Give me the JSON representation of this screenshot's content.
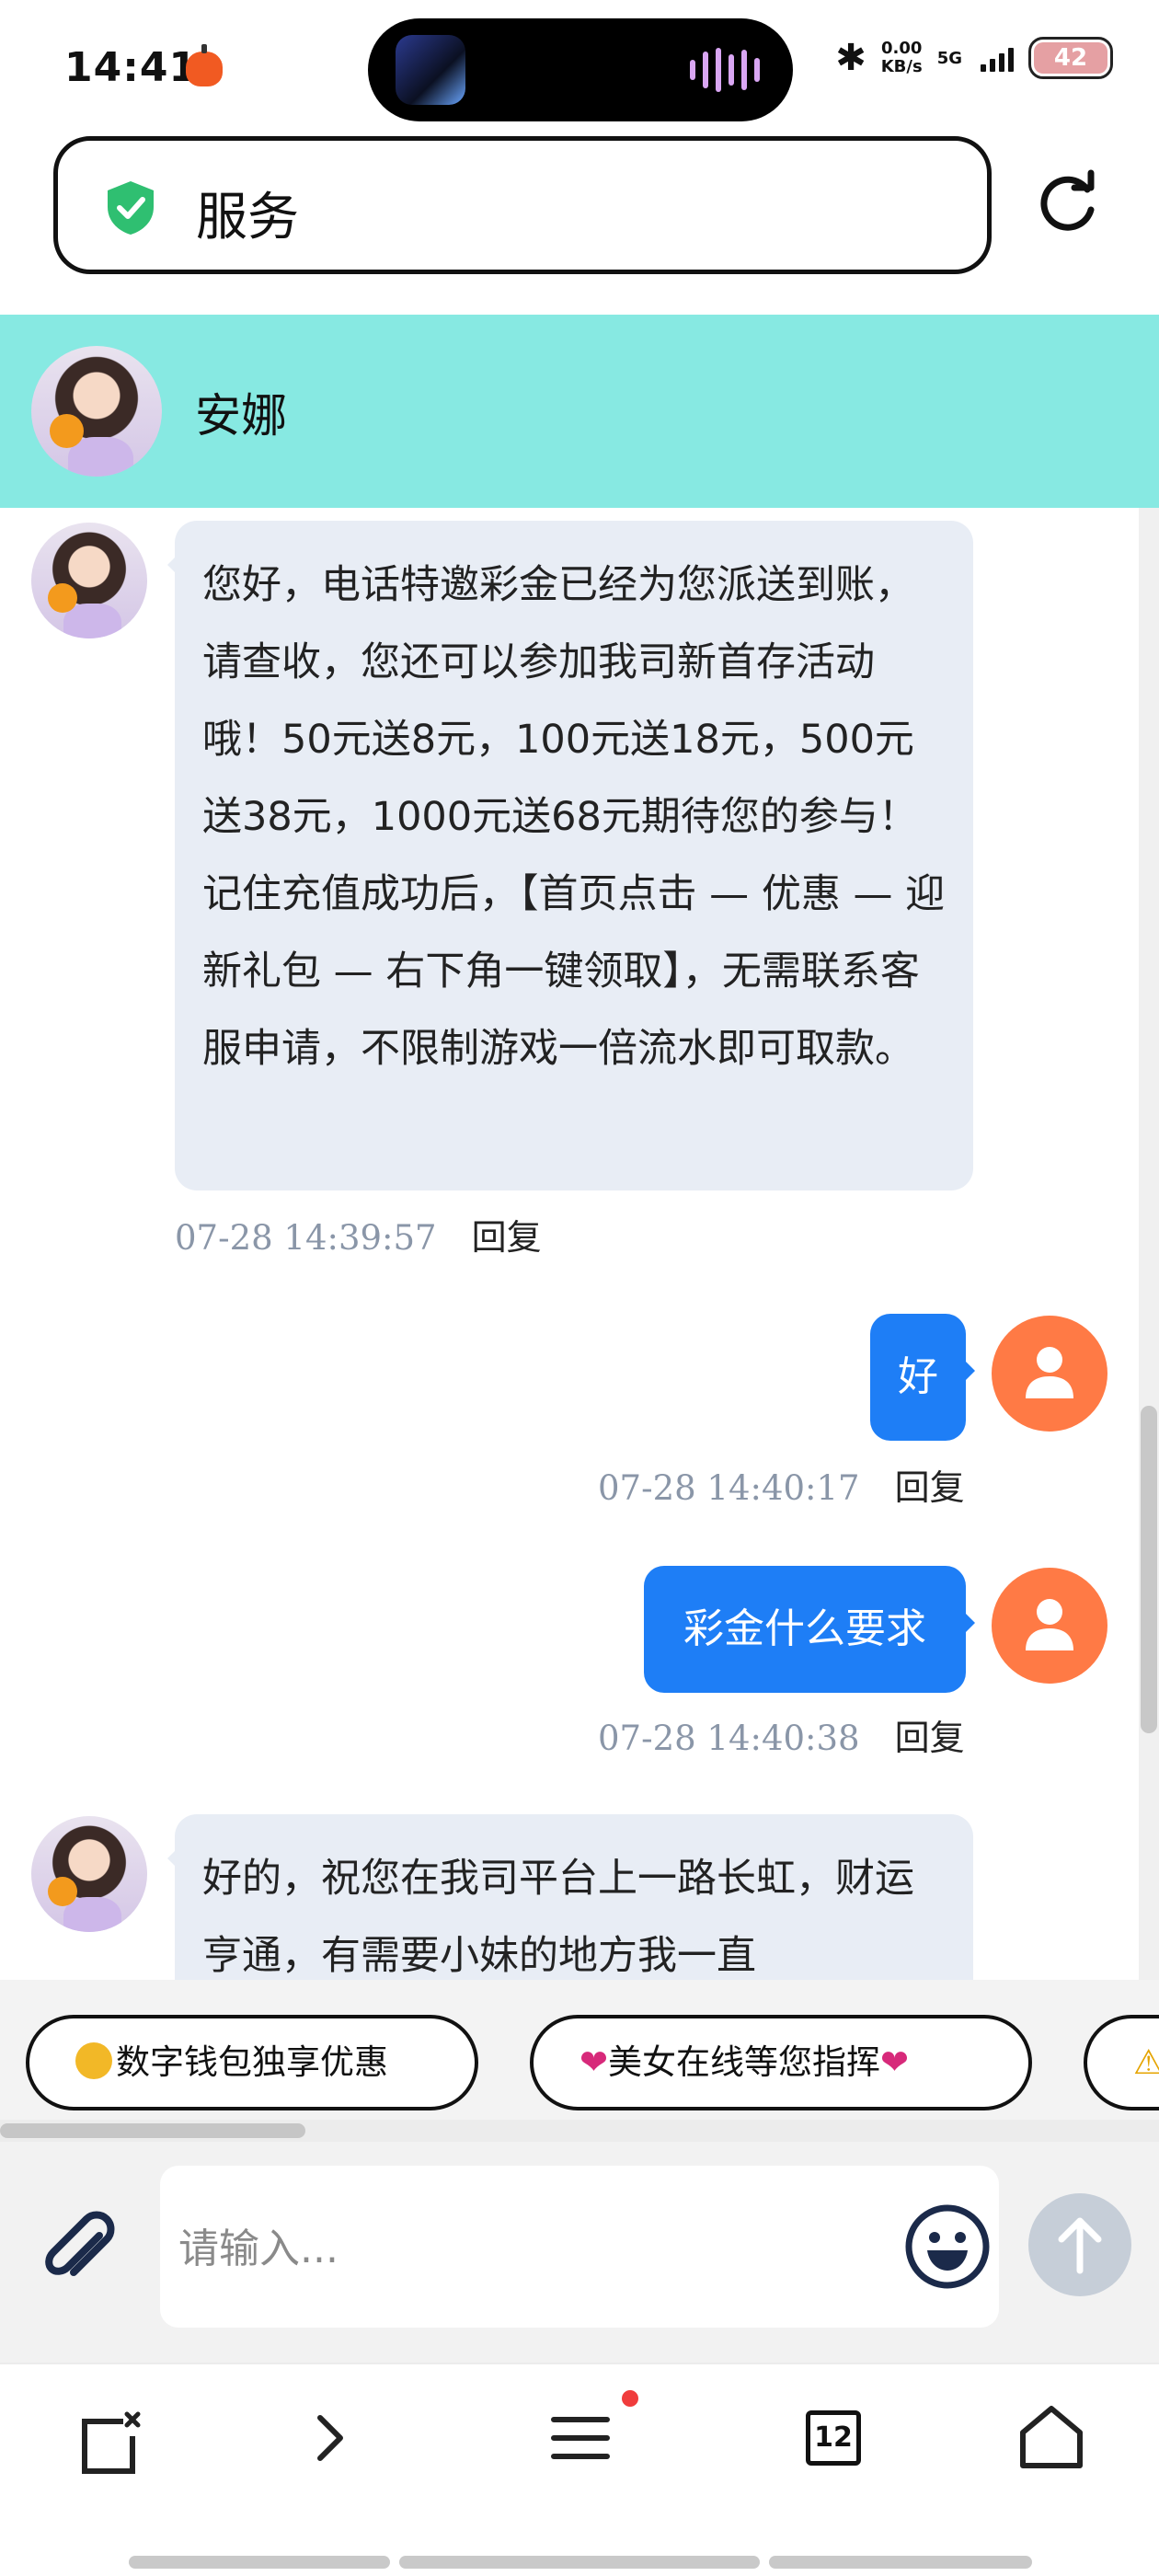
{
  "status_bar": {
    "time": "14:41",
    "net_speed_value": "0.00",
    "net_speed_unit": "KB/s",
    "network": "5G",
    "battery": "42"
  },
  "browser": {
    "url_text": "服务"
  },
  "chat": {
    "agent_name": "安娜",
    "messages": [
      {
        "sender": "agent",
        "text": "您好，电话特邀彩金已经为您派送到账，请查收，您还可以参加我司新首存活动哦！50元送8元，100元送18元，500元送38元，1000元送68元期待您的参与！记住充值成功后，【首页点击 — 优惠 — 迎新礼包 — 右下角一键领取】，无需联系客服申请，不限制游戏一倍流水即可取款。",
        "time": "07-28 14:39:57",
        "reply": "回复"
      },
      {
        "sender": "user",
        "text": "好",
        "time": "07-28 14:40:17",
        "reply": "回复"
      },
      {
        "sender": "user",
        "text": "彩金什么要求",
        "time": "07-28 14:40:38",
        "reply": "回复"
      },
      {
        "sender": "agent",
        "text": "好的，祝您在我司平台上一路长虹，财运亨通，有需要小妹的地方我一直",
        "time": "",
        "reply": ""
      }
    ]
  },
  "quick_replies": [
    "数字钱包独享优惠",
    "美女在线等您指挥",
    "⚠"
  ],
  "composer": {
    "placeholder": "请输入..."
  },
  "bottom_nav": {
    "tab_count": "12"
  },
  "colors": {
    "header_bg": "#87e9e2",
    "user_bubble": "#1e7ef6",
    "agent_bubble": "#e8edf5",
    "user_avatar": "#ff7a45"
  }
}
